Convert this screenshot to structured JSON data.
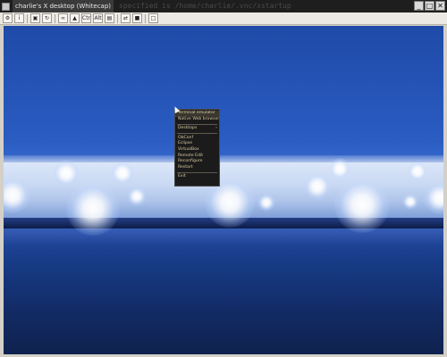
{
  "window": {
    "title": "charlie's X desktop (Whitecap)",
    "background_text": "specified is /home/charlie/.vnc/xstartup",
    "controls": [
      "_",
      "□",
      "✕"
    ]
  },
  "toolbar": {
    "buttons": [
      {
        "name": "options-icon",
        "glyph": "⚙"
      },
      {
        "name": "info-icon",
        "glyph": "i"
      },
      {
        "name": "fullscreen-icon",
        "glyph": "▣"
      },
      {
        "name": "refresh-icon",
        "glyph": "↻"
      },
      {
        "name": "ctrl-alt-del-icon",
        "glyph": "∞"
      },
      {
        "name": "lock-icon",
        "glyph": "▲"
      },
      {
        "name": "ctrl-icon",
        "glyph": "Ctrl"
      },
      {
        "name": "alt-icon",
        "glyph": "Alt"
      },
      {
        "name": "clipboard-icon",
        "glyph": "▤"
      },
      {
        "name": "transfer-icon",
        "glyph": "⇄"
      },
      {
        "name": "save-icon",
        "glyph": "■"
      },
      {
        "name": "zoom-icon",
        "glyph": "□"
      }
    ]
  },
  "menu": {
    "items": [
      {
        "label": "Terminal emulator",
        "highlight": true
      },
      {
        "label": "Native Web browser",
        "highlight": false
      },
      {
        "sep": true
      },
      {
        "label": "Desktops",
        "submenu": true
      },
      {
        "sep": true
      },
      {
        "label": "ObConf"
      },
      {
        "label": "Eclipse"
      },
      {
        "label": "VirtualBox"
      },
      {
        "label": "Remote Edit"
      },
      {
        "label": "Reconfigure"
      },
      {
        "label": "Restart"
      },
      {
        "sep": true
      },
      {
        "label": "Exit"
      }
    ]
  }
}
